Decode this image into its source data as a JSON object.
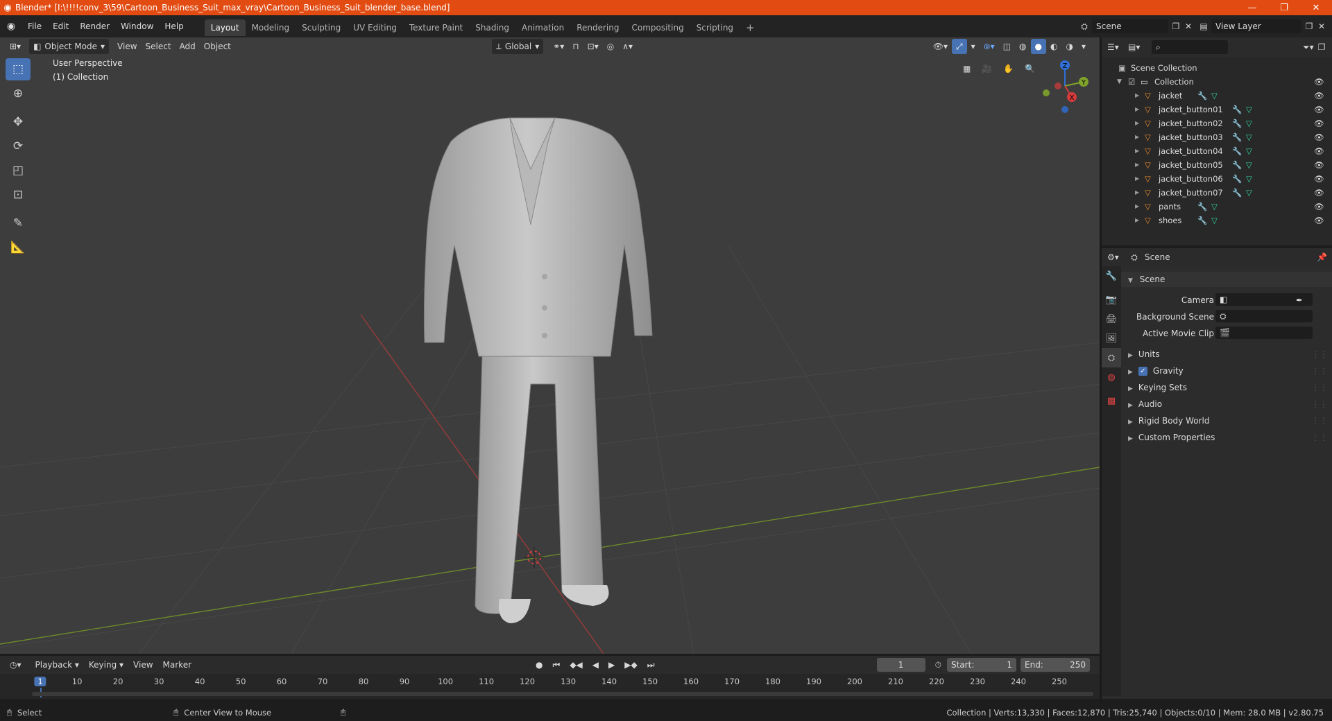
{
  "window": {
    "title": "Blender* [I:\\!!!!conv_3\\59\\Cartoon_Business_Suit_max_vray\\Cartoon_Business_Suit_blender_base.blend]",
    "minimize": "—",
    "maximize": "❐",
    "close": "✕"
  },
  "menu": [
    "File",
    "Edit",
    "Render",
    "Window",
    "Help"
  ],
  "workspaces": [
    "Layout",
    "Modeling",
    "Sculpting",
    "UV Editing",
    "Texture Paint",
    "Shading",
    "Animation",
    "Rendering",
    "Compositing",
    "Scripting"
  ],
  "workspace_add": "+",
  "scene_selector": {
    "value": "Scene"
  },
  "view_layer_selector": {
    "value": "View Layer"
  },
  "viewport": {
    "mode": "Object Mode",
    "menus": [
      "View",
      "Select",
      "Add",
      "Object"
    ],
    "transform_orientation": "Global",
    "info_line1": "User Perspective",
    "info_line2": "(1) Collection",
    "gizmo": {
      "x": "X",
      "y": "Y",
      "z": "Z"
    }
  },
  "outliner": {
    "search_placeholder": "",
    "root": "Scene Collection",
    "collection": "Collection",
    "objects": [
      "jacket",
      "jacket_button01",
      "jacket_button02",
      "jacket_button03",
      "jacket_button04",
      "jacket_button05",
      "jacket_button06",
      "jacket_button07",
      "pants",
      "shoes"
    ]
  },
  "properties": {
    "header": "Scene",
    "panel_title": "Scene",
    "camera_label": "Camera",
    "background_scene_label": "Background Scene",
    "active_movie_clip_label": "Active Movie Clip",
    "sections": [
      "Units",
      "Gravity",
      "Keying Sets",
      "Audio",
      "Rigid Body World",
      "Custom Properties"
    ],
    "gravity_checked": true
  },
  "timeline": {
    "menus": [
      "Playback",
      "Keying",
      "View",
      "Marker"
    ],
    "current_frame": "1",
    "start_label": "Start:",
    "start": "1",
    "end_label": "End:",
    "end": "250",
    "ticks": [
      "1",
      "10",
      "20",
      "30",
      "40",
      "50",
      "60",
      "70",
      "80",
      "90",
      "100",
      "110",
      "120",
      "130",
      "140",
      "150",
      "160",
      "170",
      "180",
      "190",
      "200",
      "210",
      "220",
      "230",
      "240",
      "250"
    ]
  },
  "statusbar": {
    "select": "Select",
    "center_view": "Center View to Mouse",
    "stats": "Collection | Verts:13,330 | Faces:12,870 | Tris:25,740 | Objects:0/10 | Mem: 28.0 MB | v2.80.75"
  },
  "colors": {
    "accent": "#4772b3",
    "titlebar": "#e24c12",
    "object_orange": "#e68a2e",
    "modifier_blue": "#6a9ee8",
    "mesh_green": "#2fd1a0"
  }
}
